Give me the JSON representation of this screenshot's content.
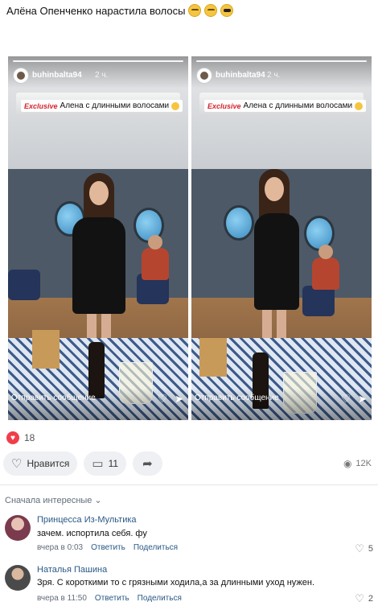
{
  "post": {
    "text": "Алёна Опенченко нарастила волосы",
    "emojis": [
      "grimacing-face",
      "grimacing-face",
      "sunglasses-face"
    ]
  },
  "stories": [
    {
      "user": "buhinbalta94",
      "time": "2 ч.",
      "caption_tag": "Exclusive",
      "caption": "Алена с длинными волосами",
      "reply_placeholder": "Отправить сообщение"
    },
    {
      "user": "buhinbalta94",
      "time": "2 ч.",
      "caption_tag": "Exclusive",
      "caption": "Алена с длинными волосами",
      "reply_placeholder": "Отправить сообщение"
    }
  ],
  "reactions": {
    "likes_count": "18"
  },
  "actions": {
    "like_label": "Нравится",
    "comments_count": "11",
    "views": "12K"
  },
  "comments_section": {
    "sort_label": "Сначала интересные"
  },
  "comments": [
    {
      "author": "Принцесса Из-Мультика",
      "text": "зачем. испортила себя. фу",
      "time": "вчера в 0:03",
      "reply": "Ответить",
      "share": "Поделиться",
      "likes": "5"
    },
    {
      "author": "Наталья Пашина",
      "text": "Зря. С короткими то с грязными ходила,а за длинными уход нужен.",
      "time": "вчера в 11:50",
      "reply": "Ответить",
      "share": "Поделиться",
      "likes": "2"
    }
  ],
  "colors": {
    "link": "#2a5885",
    "like_heart": "#ef3e4a",
    "pill_bg": "#eef0f3",
    "exclusive_red": "#d6242d"
  }
}
